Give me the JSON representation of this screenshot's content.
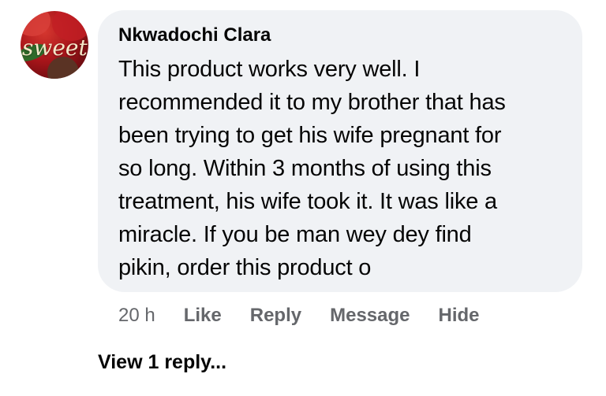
{
  "comment": {
    "author": "Nkwadochi Clara",
    "avatar": {
      "label": "sweet",
      "colors": {
        "primary": "#a8151a",
        "accent": "#f4e7c8"
      }
    },
    "lines": [
      "This product works very well. I",
      "recommended it to my brother that has",
      "been trying to get his wife pregnant for",
      "so long. Within 3 months of using this",
      "treatment, his wife took it. It was like a",
      "miracle. If you be man wey dey find",
      "pikin, order this product o"
    ],
    "timestamp": "20 h",
    "actions": {
      "like": "Like",
      "reply": "Reply",
      "message": "Message",
      "hide": "Hide"
    },
    "view_replies": "View 1 reply..."
  },
  "colors": {
    "bubble_bg": "#f0f2f5",
    "text": "#050505",
    "secondary_text": "#65676b"
  }
}
